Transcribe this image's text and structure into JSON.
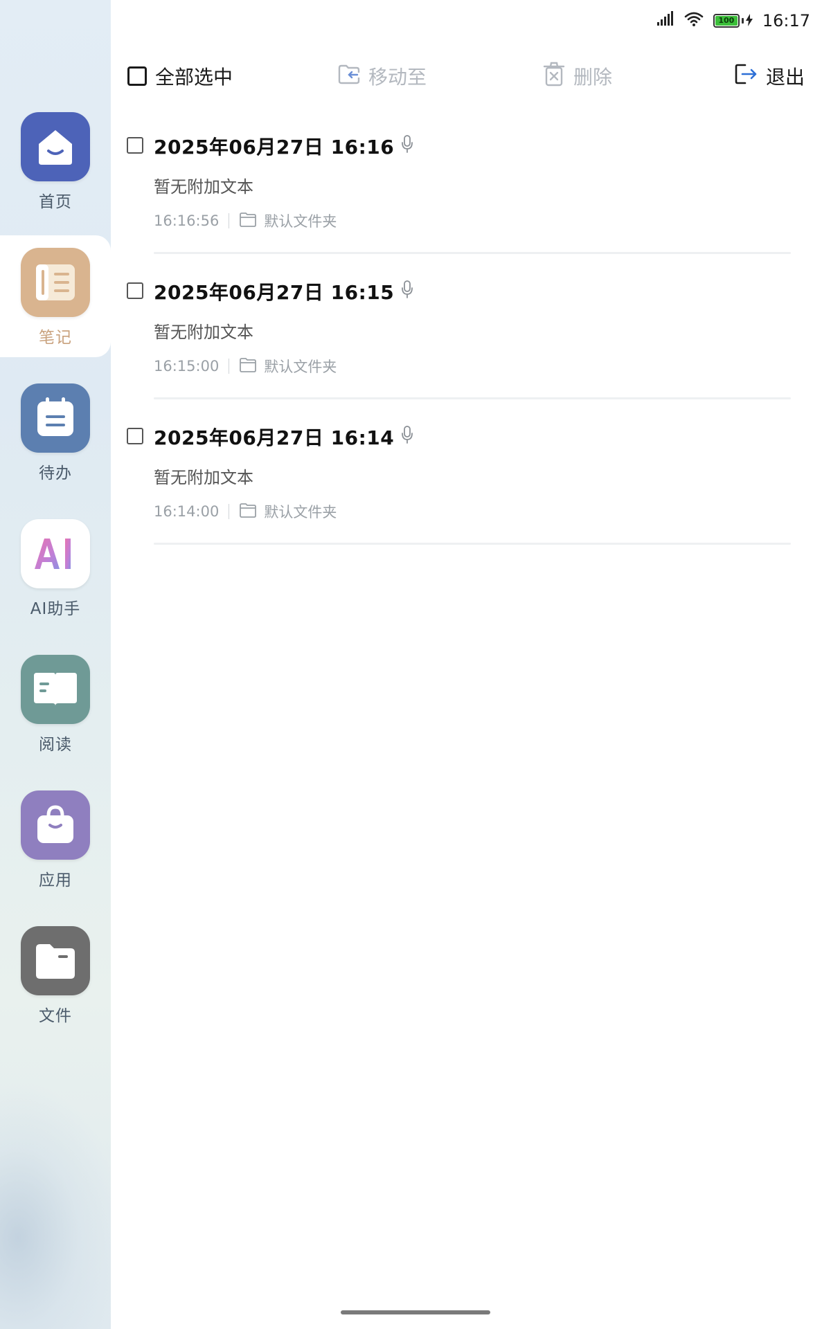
{
  "status_bar": {
    "battery_level": "100",
    "time": "16:17"
  },
  "toolbar": {
    "select_all_label": "全部选中",
    "move_to_label": "移动至",
    "delete_label": "删除",
    "exit_label": "退出"
  },
  "sidebar": {
    "items": [
      {
        "label": "首页",
        "icon": "home-icon",
        "color": "#4d63b8"
      },
      {
        "label": "笔记",
        "icon": "notebook-icon",
        "color": "#d9b48f",
        "active": true
      },
      {
        "label": "待办",
        "icon": "clipboard-icon",
        "color": "#5c7fb0"
      },
      {
        "label": "AI助手",
        "icon": "ai-icon",
        "color": "#ffffff"
      },
      {
        "label": "阅读",
        "icon": "book-icon",
        "color": "#6f9a96"
      },
      {
        "label": "应用",
        "icon": "bag-icon",
        "color": "#8f7fbf"
      },
      {
        "label": "文件",
        "icon": "folder-icon",
        "color": "#6e6e6e"
      }
    ]
  },
  "notes": [
    {
      "title": "2025年06月27日 16:16",
      "subtitle": "暂无附加文本",
      "time": "16:16:56",
      "folder": "默认文件夹"
    },
    {
      "title": "2025年06月27日 16:15",
      "subtitle": "暂无附加文本",
      "time": "16:15:00",
      "folder": "默认文件夹"
    },
    {
      "title": "2025年06月27日 16:14",
      "subtitle": "暂无附加文本",
      "time": "16:14:00",
      "folder": "默认文件夹"
    }
  ]
}
